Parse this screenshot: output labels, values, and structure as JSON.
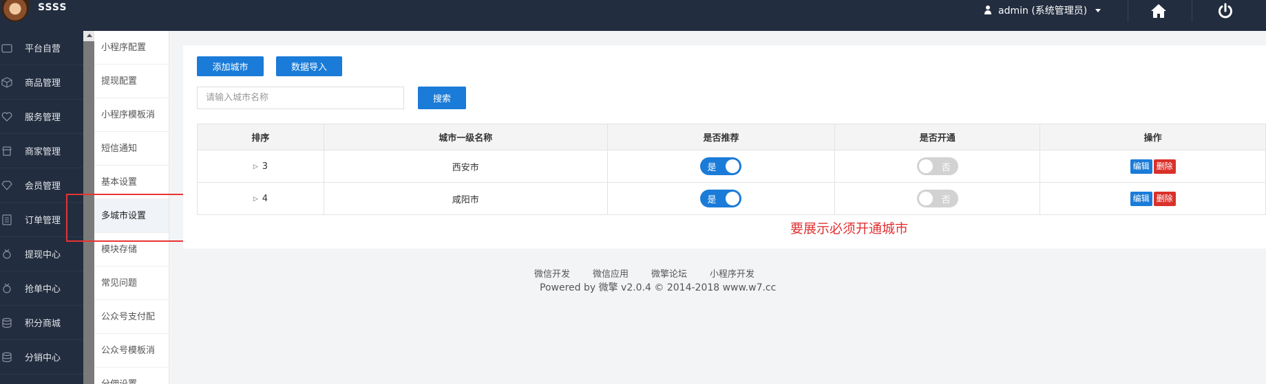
{
  "header": {
    "site_name": "SSSS",
    "user_label": "admin (系统管理员)"
  },
  "sidebar": {
    "items": [
      {
        "label": "平台自营",
        "icon": "store-icon"
      },
      {
        "label": "商品管理",
        "icon": "box-icon"
      },
      {
        "label": "服务管理",
        "icon": "heart-icon"
      },
      {
        "label": "商家管理",
        "icon": "shop-icon"
      },
      {
        "label": "会员管理",
        "icon": "diamond-icon"
      },
      {
        "label": "订单管理",
        "icon": "list-icon"
      },
      {
        "label": "提现中心",
        "icon": "medal-icon"
      },
      {
        "label": "抢单中心",
        "icon": "medal-icon"
      },
      {
        "label": "积分商城",
        "icon": "database-icon"
      },
      {
        "label": "分销中心",
        "icon": "database-icon"
      }
    ]
  },
  "submenu": {
    "items": [
      "小程序配置",
      "提现配置",
      "小程序模板消",
      "短信通知",
      "基本设置",
      "多城市设置",
      "模块存储",
      "常见问题",
      "公众号支付配",
      "公众号模板消",
      "分佣设置"
    ],
    "active": "多城市设置"
  },
  "toolbar": {
    "add_city_label": "添加城市",
    "import_label": "数据导入",
    "search_placeholder": "请输入城市名称",
    "search_label": "搜索"
  },
  "table": {
    "headers": [
      "排序",
      "城市一级名称",
      "是否推荐",
      "是否开通",
      "操作"
    ],
    "rows": [
      {
        "sort": "3",
        "name": "西安市",
        "recommended": "是",
        "open": "否",
        "edit": "编辑",
        "delete": "删除"
      },
      {
        "sort": "4",
        "name": "咸阳市",
        "recommended": "是",
        "open": "否",
        "edit": "编辑",
        "delete": "删除"
      }
    ]
  },
  "annotation": "要展示必须开通城市",
  "footer": {
    "links": [
      "微信开发",
      "微信应用",
      "微擎论坛",
      "小程序开发"
    ],
    "powered": "Powered by 微擎 v2.0.4 © 2014-2018 www.w7.cc"
  },
  "colors": {
    "topbar": "#222d3f",
    "accent": "#1a7bd8",
    "danger": "#d9312a",
    "annotation": "#e03131"
  }
}
